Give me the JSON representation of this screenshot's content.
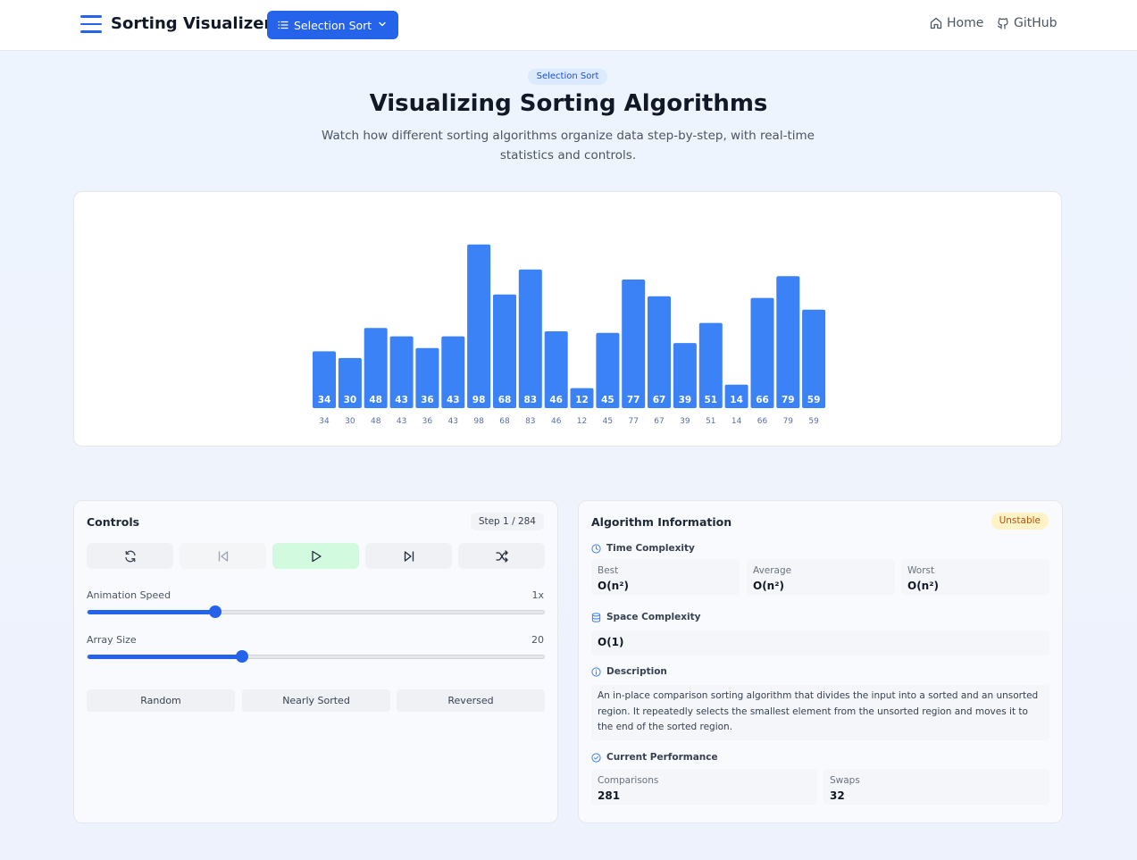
{
  "header": {
    "app_title": "Sorting Visualizer",
    "algorithm_select": "Selection Sort",
    "nav": {
      "home": "Home",
      "github": "GitHub"
    }
  },
  "hero": {
    "badge": "Selection Sort",
    "title": "Visualizing Sorting Algorithms",
    "subtitle": "Watch how different sorting algorithms organize data step-by-step, with real-time statistics and controls."
  },
  "visualizer": {
    "values": [
      34,
      30,
      48,
      43,
      36,
      43,
      98,
      68,
      83,
      46,
      12,
      45,
      77,
      67,
      39,
      51,
      14,
      66,
      79,
      59
    ],
    "bar_color": "#3b82f6",
    "index_label_color": "#5b6fa8"
  },
  "controls": {
    "title": "Controls",
    "step": "Step 1 / 284",
    "buttons": [
      "reset-icon",
      "step-back-icon",
      "play-icon",
      "step-forward-icon",
      "shuffle-icon"
    ],
    "speed": {
      "label": "Animation Speed",
      "value": "1x",
      "fraction": 0.28
    },
    "size": {
      "label": "Array Size",
      "value": "20",
      "fraction": 0.338
    },
    "presets": [
      "Random",
      "Nearly Sorted",
      "Reversed"
    ]
  },
  "info": {
    "title": "Algorithm Information",
    "stability": "Unstable",
    "time_complexity": {
      "heading": "Time Complexity",
      "best_label": "Best",
      "best": "O(n²)",
      "average_label": "Average",
      "average": "O(n²)",
      "worst_label": "Worst",
      "worst": "O(n²)"
    },
    "space_complexity": {
      "heading": "Space Complexity",
      "value": "O(1)"
    },
    "description": {
      "heading": "Description",
      "text": "An in-place comparison sorting algorithm that divides the input into a sorted and an unsorted region. It repeatedly selects the smallest element from the unsorted region and moves it to the end of the sorted region."
    },
    "performance": {
      "heading": "Current Performance",
      "comparisons_label": "Comparisons",
      "comparisons": "281",
      "swaps_label": "Swaps",
      "swaps": "32"
    }
  },
  "colors": {
    "accent": "#2563eb",
    "warning_bg": "#fef3c7",
    "success_bg": "#d1fadf"
  }
}
